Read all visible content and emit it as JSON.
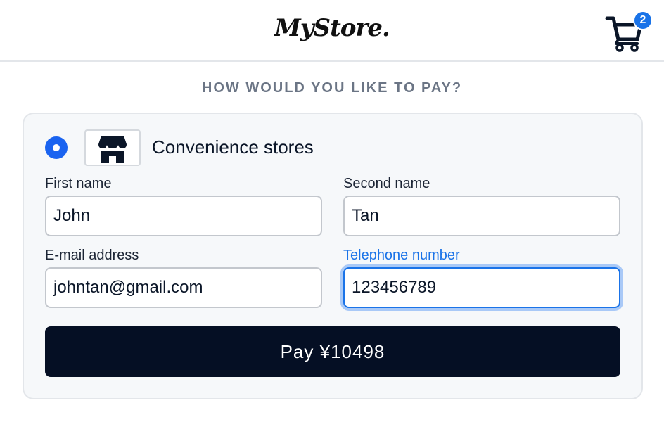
{
  "header": {
    "logo_text": "MyStore.",
    "cart_count": "2"
  },
  "page": {
    "heading": "HOW WOULD YOU LIKE TO PAY?"
  },
  "payment_method": {
    "label": "Convenience stores",
    "icon": "store-icon",
    "selected": true
  },
  "form": {
    "first_name": {
      "label": "First name",
      "value": "John"
    },
    "second_name": {
      "label": "Second name",
      "value": "Tan"
    },
    "email": {
      "label": "E-mail address",
      "value": "johntan@gmail.com"
    },
    "telephone": {
      "label": "Telephone number",
      "value": "123456789"
    }
  },
  "pay_button": {
    "label": "Pay ¥10498"
  },
  "colors": {
    "accent": "#1a73e8",
    "button_bg": "#050f24",
    "heading": "#6b7585"
  }
}
